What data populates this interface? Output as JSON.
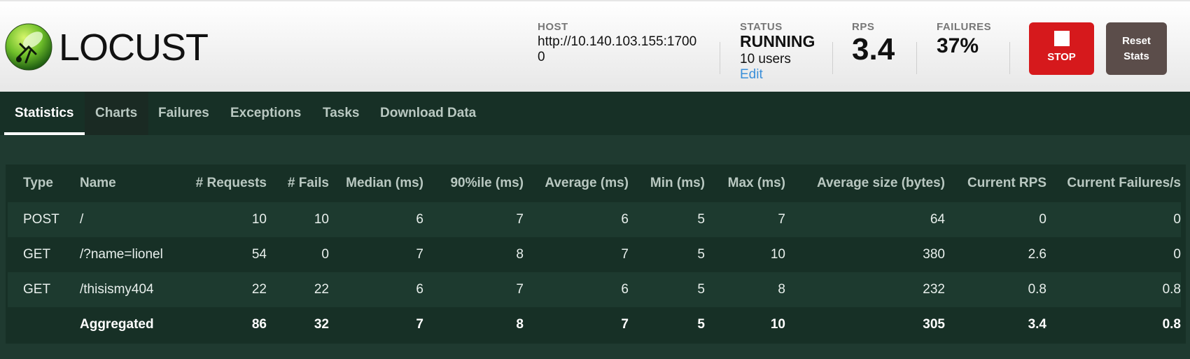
{
  "brand": {
    "name": "LOCUST"
  },
  "header": {
    "host": {
      "label": "HOST",
      "value": "http://10.140.103.155:17000"
    },
    "status": {
      "label": "STATUS",
      "value": "RUNNING",
      "users": "10 users",
      "edit_label": "Edit"
    },
    "rps": {
      "label": "RPS",
      "value": "3.4"
    },
    "failures": {
      "label": "FAILURES",
      "value": "37%"
    },
    "stop_label": "STOP",
    "reset_label_line1": "Reset",
    "reset_label_line2": "Stats"
  },
  "tabs": [
    {
      "label": "Statistics",
      "active": true
    },
    {
      "label": "Charts"
    },
    {
      "label": "Failures"
    },
    {
      "label": "Exceptions"
    },
    {
      "label": "Tasks"
    },
    {
      "label": "Download Data"
    }
  ],
  "table": {
    "columns": [
      "Type",
      "Name",
      "# Requests",
      "# Fails",
      "Median (ms)",
      "90%ile (ms)",
      "Average (ms)",
      "Min (ms)",
      "Max (ms)",
      "Average size (bytes)",
      "Current RPS",
      "Current Failures/s"
    ],
    "rows": [
      [
        "POST",
        "/",
        "10",
        "10",
        "6",
        "7",
        "6",
        "5",
        "7",
        "64",
        "0",
        "0"
      ],
      [
        "GET",
        "/?name=lionel",
        "54",
        "0",
        "7",
        "8",
        "7",
        "5",
        "10",
        "380",
        "2.6",
        "0"
      ],
      [
        "GET",
        "/thisismy404",
        "22",
        "22",
        "6",
        "7",
        "6",
        "5",
        "8",
        "232",
        "0.8",
        "0.8"
      ],
      [
        "",
        "Aggregated",
        "86",
        "32",
        "7",
        "8",
        "7",
        "5",
        "10",
        "305",
        "3.4",
        "0.8"
      ]
    ]
  }
}
